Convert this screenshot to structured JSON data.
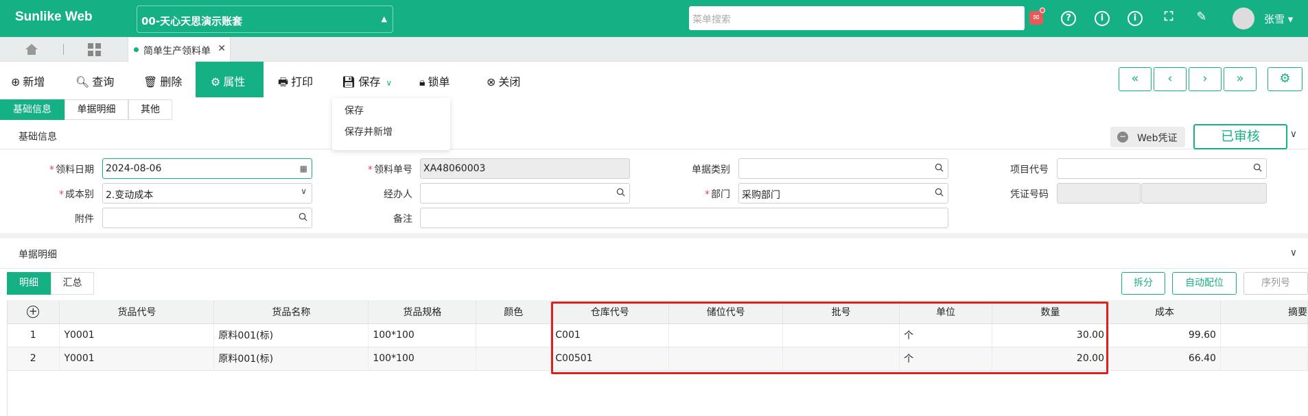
{
  "app": {
    "brand": "Sunlike Web",
    "account": "00-天心天思演示账套",
    "search_placeholder": "菜单搜索",
    "user": "张雪"
  },
  "tabs": {
    "active": "简单生产领料单"
  },
  "toolbar": {
    "add": "新增",
    "query": "查询",
    "delete": "删除",
    "props": "属性",
    "print": "打印",
    "save": "保存",
    "lock": "锁单",
    "close": "关闭"
  },
  "save_menu": {
    "item1": "保存",
    "item2": "保存并新增"
  },
  "subtabs": {
    "basic": "基础信息",
    "detail": "单据明细",
    "other": "其他"
  },
  "basic_section": {
    "title": "基础信息",
    "web_voucher": "Web凭证",
    "status": "已审核"
  },
  "form": {
    "date_label": "领料日期",
    "date_value": "2024-08-06",
    "no_label": "领料单号",
    "no_value": "XA48060003",
    "doctype_label": "单据类别",
    "doctype_value": "",
    "project_label": "项目代号",
    "project_value": "",
    "costtype_label": "成本别",
    "costtype_value": "2.变动成本",
    "handler_label": "经办人",
    "handler_value": "",
    "dept_label": "部门",
    "dept_value": "采购部门",
    "voucher_label": "凭证号码",
    "attach_label": "附件",
    "attach_value": "",
    "remark_label": "备注",
    "remark_value": ""
  },
  "detail_section": {
    "title": "单据明细"
  },
  "list_tabs": {
    "detail": "明细",
    "summary": "汇总"
  },
  "list_buttons": {
    "split": "拆分",
    "auto_assign": "自动配位",
    "serial": "序列号"
  },
  "table": {
    "columns": [
      "货品代号",
      "货品名称",
      "货品规格",
      "颜色",
      "仓库代号",
      "储位代号",
      "批号",
      "单位",
      "数量",
      "成本",
      "摘要"
    ],
    "rows": [
      {
        "no": "1",
        "code": "Y0001",
        "name": "原料001(标)",
        "spec": "100*100",
        "color": "",
        "wh": "C001",
        "loc": "",
        "batch": "",
        "unit": "个",
        "qty": "30.00",
        "cost": "99.60",
        "memo": ""
      },
      {
        "no": "2",
        "code": "Y0001",
        "name": "原料001(标)",
        "spec": "100*100",
        "color": "",
        "wh": "C00501",
        "loc": "",
        "batch": "",
        "unit": "个",
        "qty": "20.00",
        "cost": "66.40",
        "memo": ""
      }
    ]
  }
}
